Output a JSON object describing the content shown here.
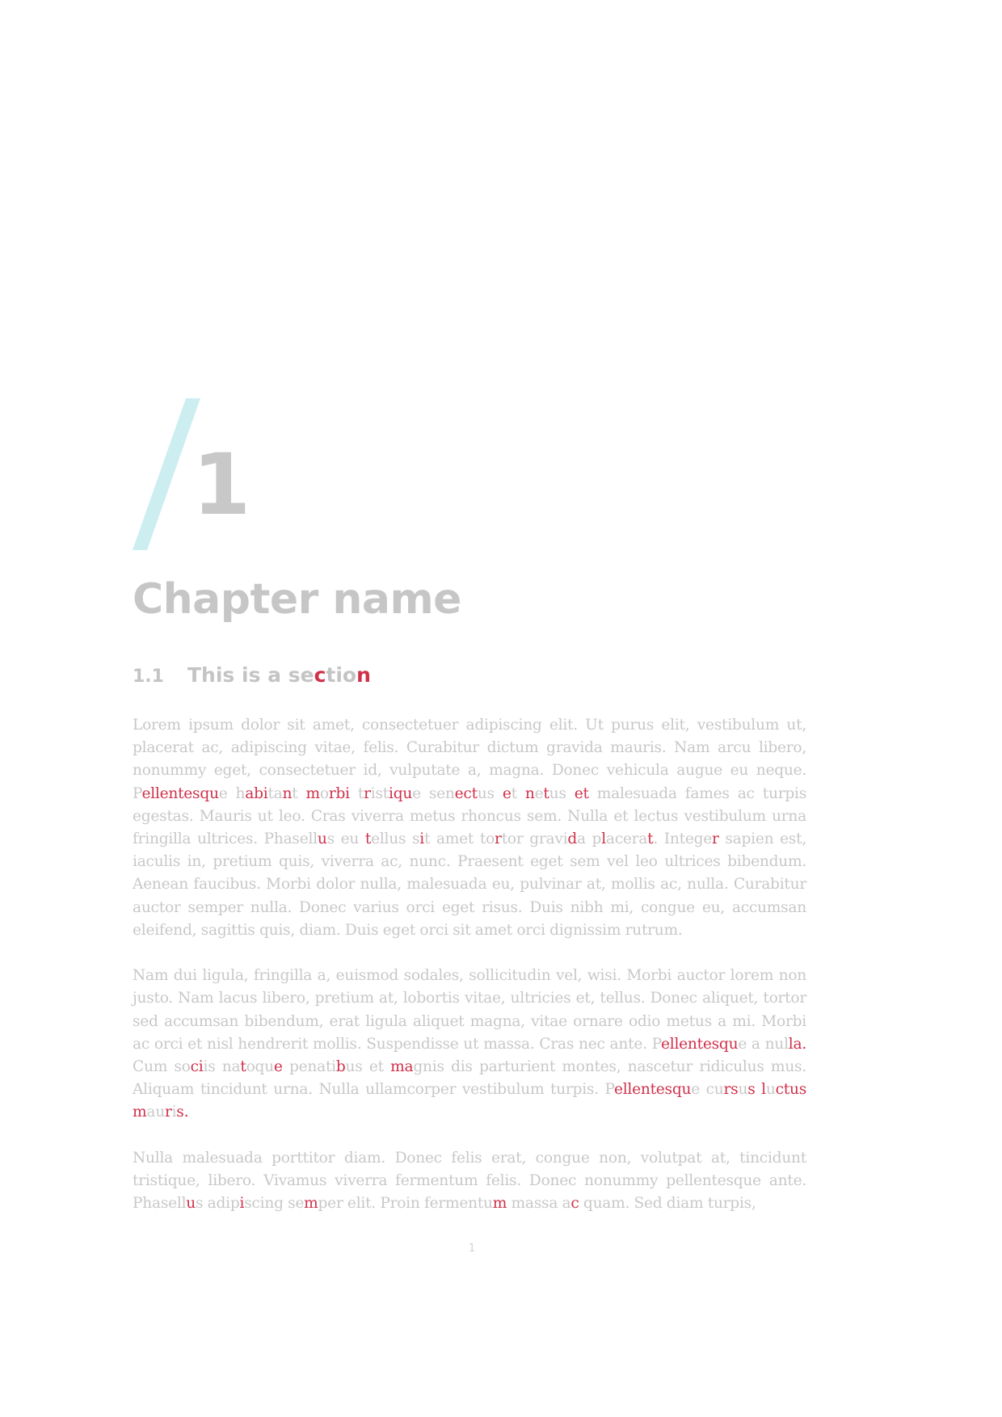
{
  "colors": {
    "accent_slash": "#cdeef1",
    "heading_gray": "#c6c6c6",
    "body_gray": "#c8c8c8",
    "highlight_red": "#d0304a"
  },
  "chapter": {
    "number": "1",
    "title": "Chapter name",
    "decoration_icon": "slash-accent"
  },
  "section": {
    "number": "1.1",
    "title_start": "This is a se",
    "title_hl1": "c",
    "title_mid": "tio",
    "title_hl2": "n"
  },
  "paragraphs": [
    [
      "Lorem ipsum dolor sit amet, consectetuer adipiscing elit. Ut purus elit, vestibulum ut, placerat ac, adipiscing vitae, felis. Curabitur dictum gravida mauris. Nam arcu libero, nonummy eget, consectetuer id, vulputate a, magna. Donec vehicula augue eu neque. P",
      {
        "hl": "ellentesqu"
      },
      "e h",
      {
        "hl": "abi"
      },
      "ta",
      {
        "hl": "n"
      },
      "t ",
      {
        "hl": "m"
      },
      "o",
      {
        "hl": "rbi"
      },
      " t",
      {
        "hl": "r"
      },
      "ist",
      {
        "hl": "iqu"
      },
      "e sen",
      {
        "hl": "ect"
      },
      "us ",
      {
        "hl": "e"
      },
      "t ",
      {
        "hl": "n"
      },
      "e",
      {
        "hl": "t"
      },
      "us ",
      {
        "hl": "et"
      },
      " malesuada fames ac turpis egestas. Mauris ut leo. Cras viverra metus rhoncus sem. Nulla et lectus vestibulum urna fringilla ultrices. Phasell",
      {
        "hl": "u"
      },
      "s eu ",
      {
        "hl": "t"
      },
      "ellus s",
      {
        "hl": "i"
      },
      "t amet to",
      {
        "hl": "r"
      },
      "tor gravi",
      {
        "hl": "d"
      },
      "a p",
      {
        "hl": "l"
      },
      "acera",
      {
        "hl": "t"
      },
      ". Intege",
      {
        "hl": "r"
      },
      " sapien est, iaculis in, pretium quis, viverra ac, nunc. Praesent eget sem vel leo ultrices bibendum. Aenean faucibus. Morbi dolor nulla, malesuada eu, pulvinar at, mollis ac, nulla. Curabitur auctor semper nulla. Donec varius orci eget risus. Duis nibh mi, congue eu, accumsan eleifend, sagittis quis, diam. Duis eget orci sit amet orci dignissim rutrum."
    ],
    [
      "Nam dui ligula, fringilla a, euismod sodales, sollicitudin vel, wisi. Morbi auctor lorem non justo. Nam lacus libero, pretium at, lobortis vitae, ultricies et, tellus. Donec aliquet, tortor sed accumsan bibendum, erat ligula aliquet magna, vitae ornare odio metus a mi. Morbi ac orci et nisl hendrerit mollis. Suspendisse ut massa. Cras nec ante. P",
      {
        "hl": "ellentesqu"
      },
      "e a nul",
      {
        "hl": "la."
      },
      " Cum so",
      {
        "hl": "ci"
      },
      "is na",
      {
        "hl": "t"
      },
      "oqu",
      {
        "hl": "e"
      },
      " penati",
      {
        "hl": "b"
      },
      "us et ",
      {
        "hl": "ma"
      },
      "gnis dis parturient montes, nascetur ridiculus mus. Aliquam tincidunt urna. Nulla ullamcorper vestibulum turpis. P",
      {
        "hl": "ellentesqu"
      },
      "e cu",
      {
        "hl": "rs"
      },
      "u",
      {
        "hl": "s"
      },
      " ",
      {
        "hl": "l"
      },
      "u",
      {
        "hl": "ctus"
      },
      " ",
      {
        "hl": "m"
      },
      "au",
      {
        "hl": "r"
      },
      "i",
      {
        "hl": "s."
      }
    ],
    [
      "Nulla malesuada porttitor diam. Donec felis erat, congue non, volutpat at, tincidunt tristique, libero. Vivamus viverra fermentum felis. Donec nonummy pellentesque ante. Phasell",
      {
        "hl": "u"
      },
      "s adip",
      {
        "hl": "i"
      },
      "scing se",
      {
        "hl": "m"
      },
      "per elit. Proin fermentu",
      {
        "hl": "m"
      },
      " massa a",
      {
        "hl": "c"
      },
      " quam. Sed diam turpis,"
    ]
  ],
  "footer": {
    "page_number": "1"
  }
}
